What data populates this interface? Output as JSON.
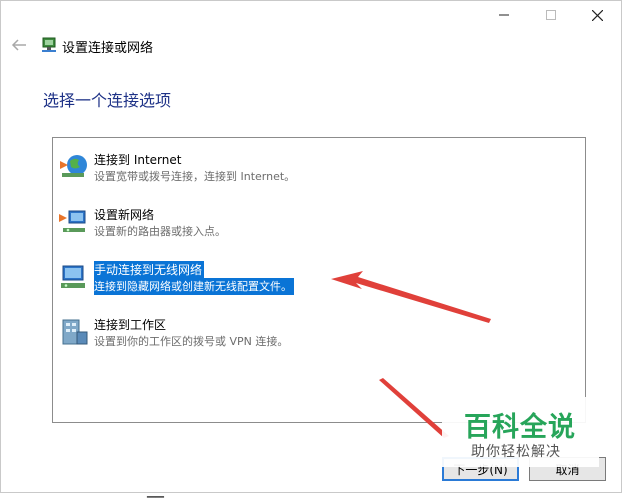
{
  "window": {
    "title": "设置连接或网络",
    "controls": [
      "minimize",
      "maximize",
      "close"
    ]
  },
  "heading": "选择一个连接选项",
  "options": [
    {
      "title": "连接到 Internet",
      "desc": "设置宽带或拨号连接，连接到 Internet。",
      "icon": "globe-network-icon",
      "selected": false
    },
    {
      "title": "设置新网络",
      "desc": "设置新的路由器或接入点。",
      "icon": "new-network-icon",
      "selected": false
    },
    {
      "title": "手动连接到无线网络",
      "desc": "连接到隐藏网络或创建新无线配置文件。",
      "icon": "wireless-network-icon",
      "selected": true
    },
    {
      "title": "连接到工作区",
      "desc": "设置到你的工作区的拨号或 VPN 连接。",
      "icon": "workplace-icon",
      "selected": false
    }
  ],
  "buttons": {
    "next": "下一步(N)",
    "cancel": "取消"
  },
  "watermark": {
    "title": "百科全说",
    "subtitle": "助你轻松解决"
  },
  "colors": {
    "heading": "#1e3287",
    "selection": "#0a74d6",
    "annotation_arrow": "#e0403a",
    "watermark": "#27a55a"
  }
}
